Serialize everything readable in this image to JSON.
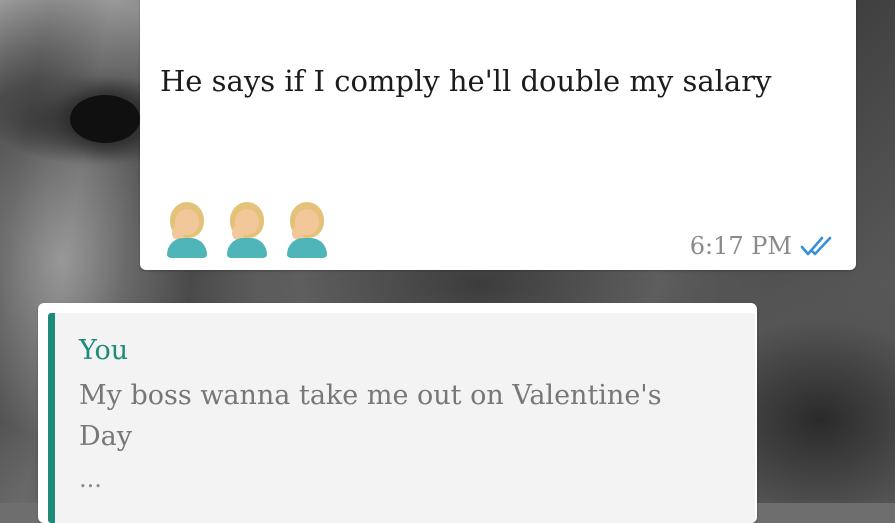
{
  "outgoing_message": {
    "text": "He says if I comply he'll double my salary",
    "emojis": [
      "woman-facepalming-icon",
      "woman-facepalming-icon",
      "woman-facepalming-icon"
    ],
    "time": "6:17 PM",
    "status": "read-double-check-icon"
  },
  "quoted_message": {
    "author": "You",
    "text": "My boss wanna take me out on Valentine's Day",
    "ellipsis": "..."
  },
  "colors": {
    "accent": "#1e8a7a",
    "read_ticks": "#3a8fd6",
    "skin": "#f2c79a",
    "hair": "#e4c27a",
    "shirt": "#4fb5b8"
  }
}
